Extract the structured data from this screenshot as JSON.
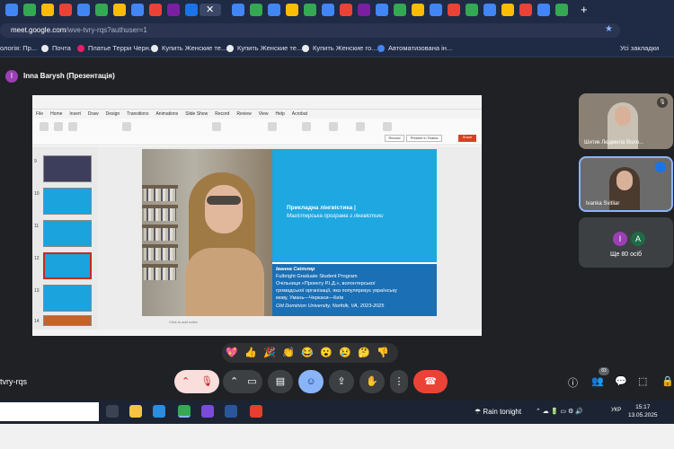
{
  "browser": {
    "url_host": "meet.google.com",
    "url_path": "/wve-tvry-rqs?authuser=1",
    "bookmarks": [
      "ологія: Пр...",
      "Почта",
      "Платье Терри Черн...",
      "Купить Женские те...",
      "Купить Женские те...",
      "Купить Женские го...",
      "Автоматизована ін..."
    ],
    "all_bookmarks": "Усі закладки"
  },
  "meet": {
    "presenter_initial": "I",
    "presenter_label": "Inna Barysh (Презентація)",
    "meeting_code": "tvry-rqs",
    "participant_count": "83",
    "tiles": [
      {
        "name": "Шитик Людмила Воло..."
      },
      {
        "name": "Ivanka Svitliar"
      },
      {
        "initials": [
          "I",
          "A"
        ],
        "label": "Ще 80 осіб"
      }
    ],
    "reactions": [
      "💖",
      "👍",
      "🎉",
      "👏",
      "😂",
      "😮",
      "😢",
      "🤔",
      "👎"
    ]
  },
  "ppt": {
    "tabs": [
      "File",
      "Home",
      "Insert",
      "Draw",
      "Design",
      "Transitions",
      "Animations",
      "Slide Show",
      "Record",
      "Review",
      "View",
      "Help",
      "Acrobat"
    ],
    "record_label": "Record",
    "present_label": "Present in Teams",
    "share_label": "Share",
    "thumb_numbers": [
      "9",
      "10",
      "11",
      "12",
      "13",
      "14"
    ],
    "notes_placeholder": "Click to add notes",
    "slide": {
      "title": "Прикладна лінгвістика |",
      "subtitle": "Магістерська програма з лінгвістики",
      "bio": [
        "Іванна Світляр",
        "Fulbright Graduate Student Program",
        "Очільниця «Проекту Р.І.Д.», волонтерської",
        "громадської організації, яка популяризує українську",
        "мову, Умань—Черкаси—Київ",
        "Old Dominion University, Norfolk, VA, 2023-2025"
      ]
    }
  },
  "taskbar": {
    "weather": "Rain tonight",
    "lang": "УКР",
    "time": "15:17",
    "date": "13.05.2025"
  },
  "colors": {
    "slide_blue": "#1ea7e0",
    "slide_dark_blue": "#1a6fb5",
    "hangup": "#ea4335",
    "accent": "#8ab4f8"
  }
}
